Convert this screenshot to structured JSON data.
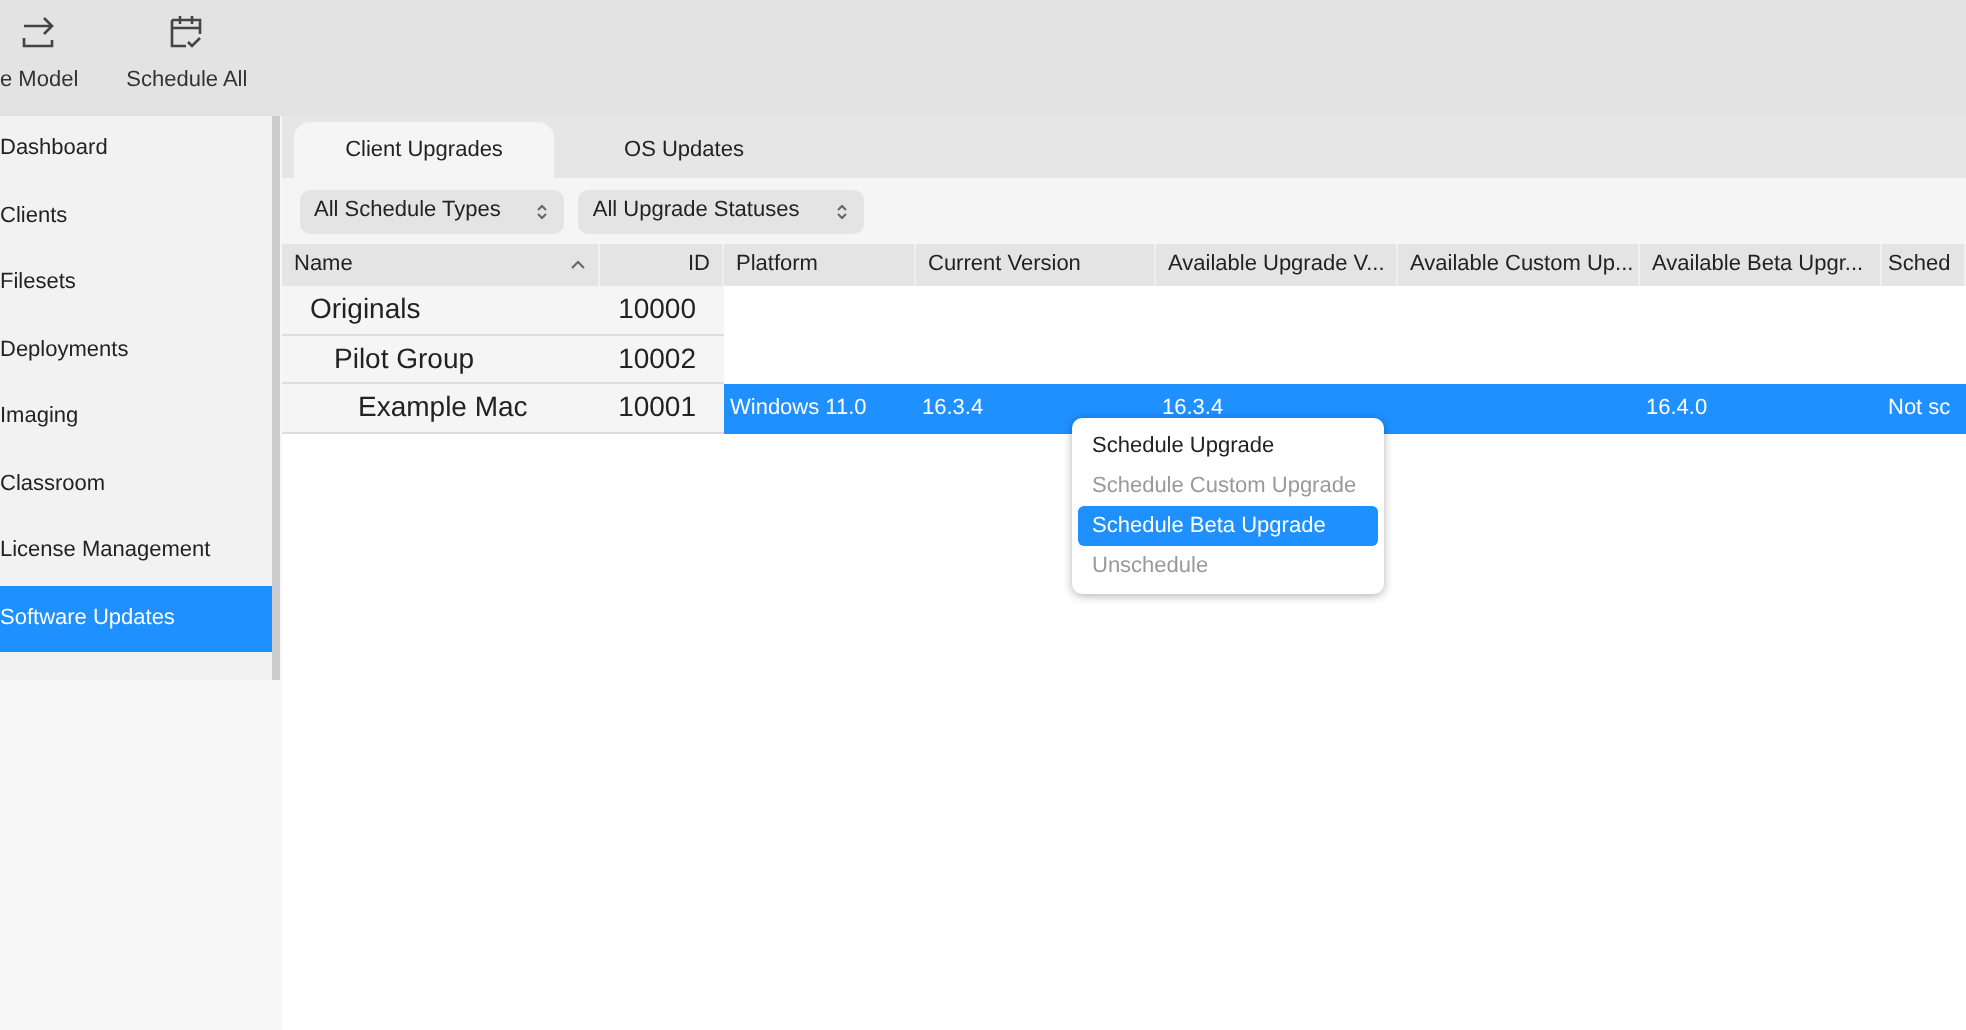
{
  "toolbar": [
    {
      "label": "e Model",
      "kind": "export"
    },
    {
      "label": "Schedule All",
      "kind": "calendar"
    }
  ],
  "sidebar": {
    "items": [
      {
        "label": "Dashboard",
        "selected": false
      },
      {
        "label": "Clients",
        "selected": false
      },
      {
        "label": "Filesets",
        "selected": false
      },
      {
        "label": "Deployments",
        "selected": false
      },
      {
        "label": "Imaging",
        "selected": false
      },
      {
        "label": "Classroom",
        "selected": false
      },
      {
        "label": "License Management",
        "selected": false
      },
      {
        "label": "Software Updates",
        "selected": true
      }
    ]
  },
  "tabs": [
    {
      "label": "Client Upgrades",
      "selected": true
    },
    {
      "label": "OS Updates",
      "selected": false
    }
  ],
  "filters": [
    {
      "value": "All Schedule Types"
    },
    {
      "value": "All Upgrade Statuses"
    }
  ],
  "table": {
    "columns": [
      {
        "label": "Name",
        "sort_ascending": true
      },
      {
        "label": "ID"
      },
      {
        "label": "Platform"
      },
      {
        "label": "Current Version"
      },
      {
        "label": "Available Upgrade V..."
      },
      {
        "label": "Available Custom Up..."
      },
      {
        "label": "Available Beta Upgr..."
      },
      {
        "label": "Sched"
      }
    ],
    "rows": [
      {
        "name": "Originals",
        "id": "10000",
        "selected": false,
        "children": [
          {
            "name": "Pilot Group",
            "id": "10002",
            "selected": false,
            "children": [
              {
                "name": "Example Mac",
                "id": "10001",
                "selected": true,
                "cells": [
                  "Windows 11.0",
                  "16.3.4",
                  "16.3.4",
                  null,
                  "16.4.0",
                  "Not sc"
                ]
              }
            ]
          }
        ]
      }
    ]
  },
  "context_menu": {
    "items": [
      {
        "label": "Schedule Upgrade",
        "disabled": false,
        "selected": false
      },
      {
        "label": "Schedule Custom Upgrade",
        "disabled": true,
        "selected": false
      },
      {
        "label": "Schedule Beta Upgrade",
        "disabled": false,
        "selected": true
      },
      {
        "label": "Unschedule",
        "disabled": true,
        "selected": false
      }
    ]
  }
}
